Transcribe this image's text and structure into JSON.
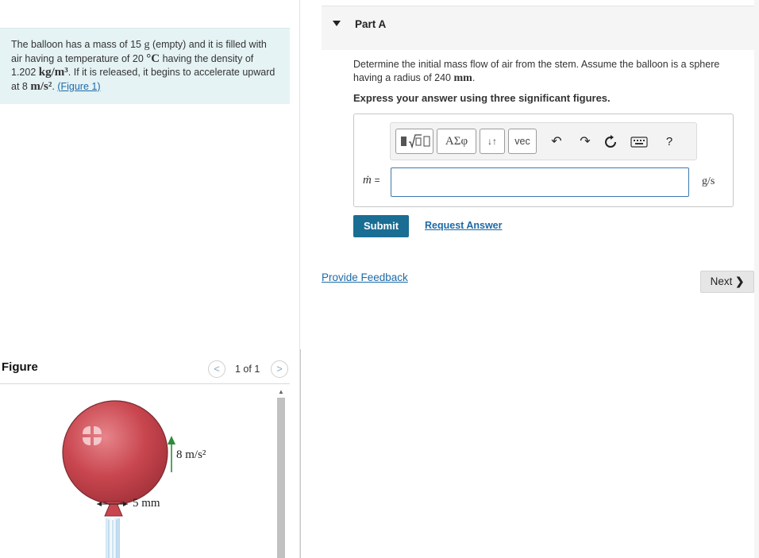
{
  "problem": {
    "text_1": "The balloon has a mass of 15",
    "unit_g": "g",
    "text_2": "(empty) and it is filled with air having a temperature of 20",
    "unit_c": "°C",
    "text_3": "having the density of 1.202",
    "unit_density": "kg/m³",
    "text_4": ". If it is released, it begins to accelerate upward at 8",
    "unit_acc": "m/s²",
    "text_5": ".",
    "figure_link": "(Figure 1)"
  },
  "figure": {
    "title": "Figure",
    "counter": "1 of 1",
    "prev_icon": "chevron-left-icon",
    "next_icon": "chevron-right-icon",
    "accel_label": "8 m/s²",
    "stem_label": "5 mm",
    "balloon_color": "#c9464f"
  },
  "part": {
    "title": "Part A",
    "question_1": "Determine the initial mass flow of air from the stem. Assume the balloon is a sphere having a radius of 240",
    "question_unit": "mm",
    "question_end": ".",
    "instruction": "Express your answer using three significant figures."
  },
  "toolbar": {
    "templates_icon": "templates-icon",
    "greek": "ΑΣφ",
    "arrows": "↓↑",
    "vec": "vec",
    "undo_icon": "undo-icon",
    "redo_icon": "redo-icon",
    "reset_icon": "reset-icon",
    "keyboard_icon": "keyboard-icon",
    "help": "?"
  },
  "answer": {
    "label": "ṁ",
    "equals": "=",
    "value": "",
    "unit": "g/s"
  },
  "actions": {
    "submit": "Submit",
    "request_answer": "Request Answer",
    "provide_feedback": "Provide Feedback",
    "next": "Next",
    "next_icon": "chevron-right-icon"
  },
  "colors": {
    "problem_bg": "#e5f3f5",
    "link": "#1c6aa8",
    "submit_bg": "#1a6d93",
    "input_border": "#3b7ab0"
  }
}
